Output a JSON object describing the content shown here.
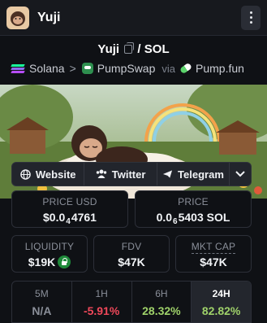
{
  "app": {
    "title": "Yuji"
  },
  "pair": {
    "base": "Yuji",
    "slash": "/",
    "quote": "SOL"
  },
  "crumbs": {
    "chain": "Solana",
    "sep": ">",
    "dex": "PumpSwap",
    "via": "via",
    "launchpad": "Pump.fun"
  },
  "links": [
    {
      "label": "Website",
      "icon": "globe-icon"
    },
    {
      "label": "Twitter",
      "icon": "users-icon"
    },
    {
      "label": "Telegram",
      "icon": "send-icon"
    }
  ],
  "stats": {
    "price_usd": {
      "label": "PRICE USD",
      "prefix": "$0.0",
      "sub": "4",
      "rest": "4761"
    },
    "price_sol": {
      "label": "PRICE",
      "prefix": "0.0",
      "sub": "6",
      "rest": "5403 SOL"
    },
    "liquidity": {
      "label": "LIQUIDITY",
      "value": "$19K"
    },
    "fdv": {
      "label": "FDV",
      "value": "$47K"
    },
    "mkt_cap": {
      "label": "MKT CAP",
      "value": "$47K"
    }
  },
  "changes": [
    {
      "label": "5M",
      "value": "N/A",
      "color": "#8a8f99"
    },
    {
      "label": "1H",
      "value": "-5.91%",
      "color": "#f0485a"
    },
    {
      "label": "6H",
      "value": "28.32%",
      "color": "#9fd26a"
    },
    {
      "label": "24H",
      "value": "82.82%",
      "color": "#9fd26a"
    }
  ],
  "colors": {
    "accent_green": "#9fd26a",
    "accent_red": "#f0485a",
    "panel_bg": "#0f1115"
  }
}
